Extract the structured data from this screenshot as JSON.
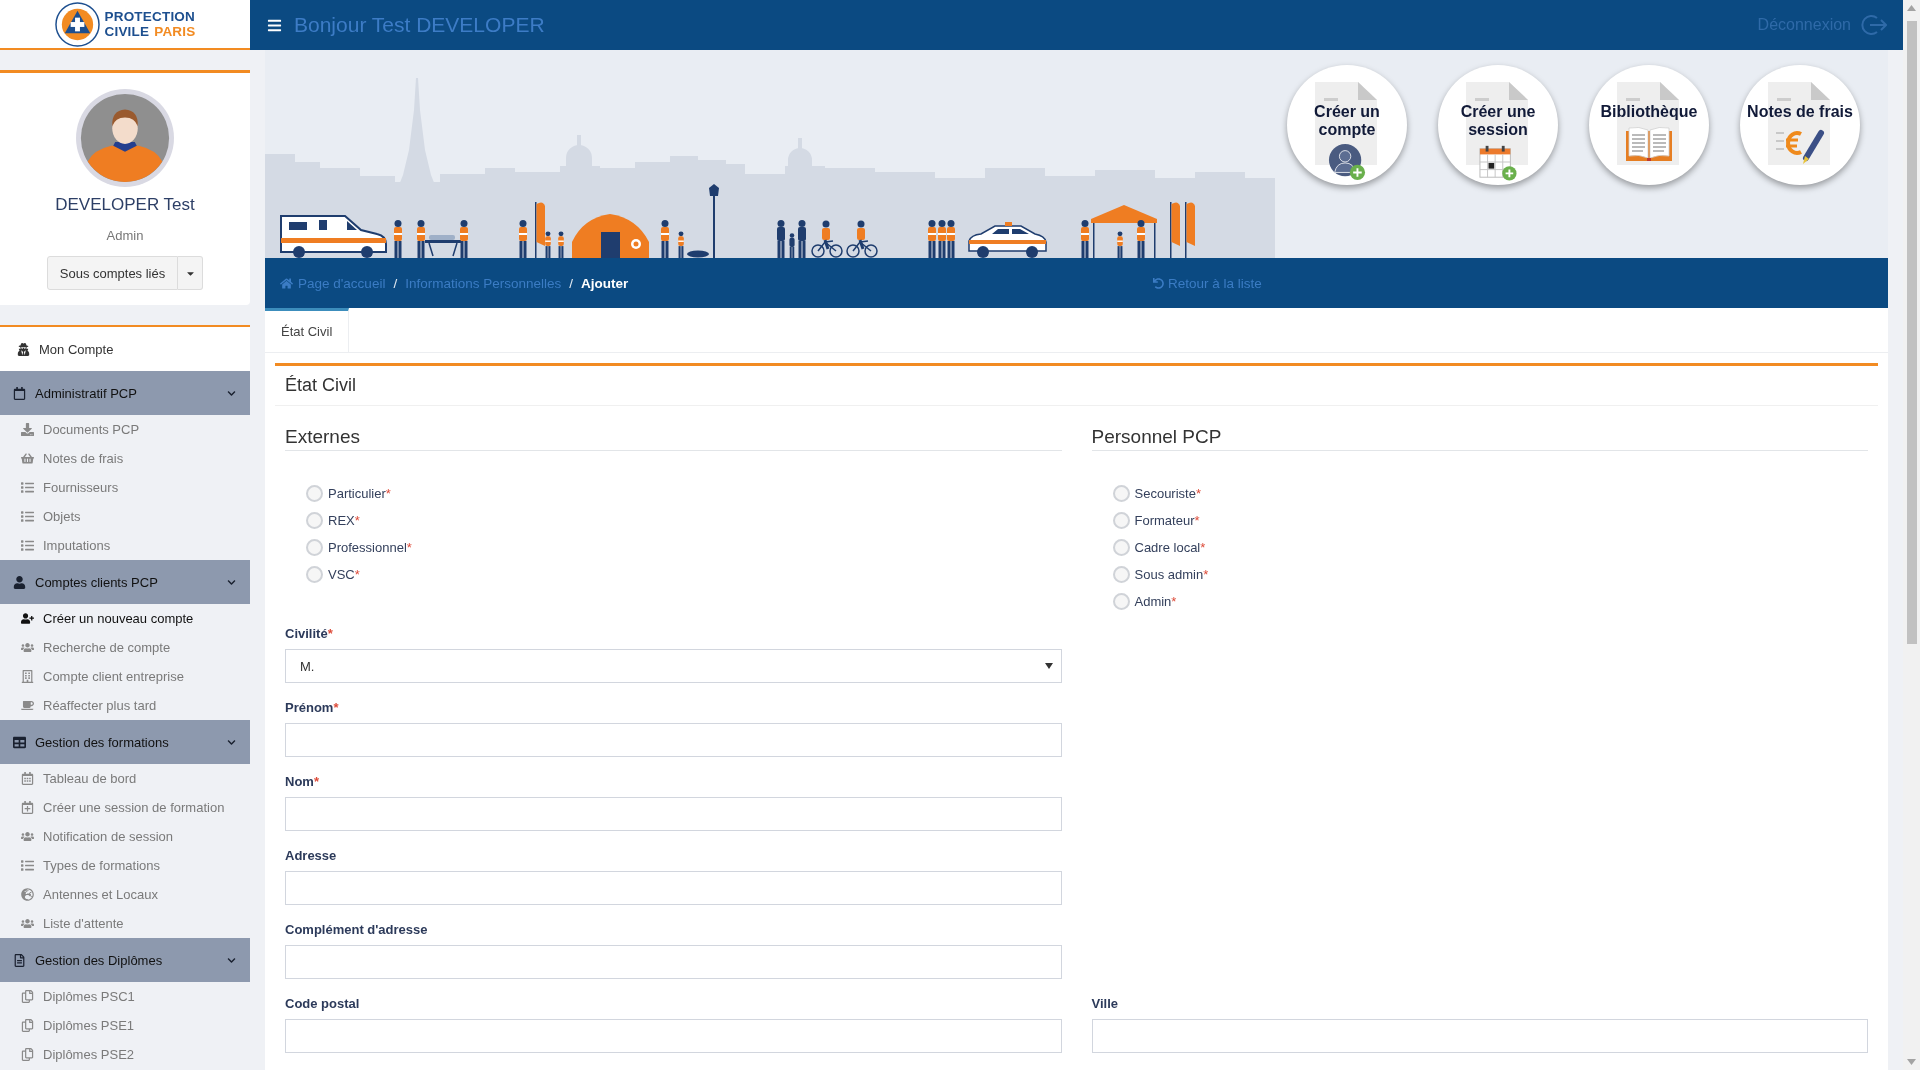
{
  "logo": {
    "title": "PROTECTION",
    "subtitle": "CIVILE",
    "accent": "PARIS"
  },
  "top_bar": {
    "greeting": "Bonjour Test DEVELOPER",
    "logout": "Déconnexion"
  },
  "sidebar": {
    "profile": {
      "name": "DEVELOPER Test",
      "role": "Admin",
      "linked_accounts_button": "Sous comptes liés"
    },
    "menu": [
      {
        "kind": "link",
        "label": "Mon Compte"
      },
      {
        "kind": "group",
        "label": "Administratif PCP",
        "expanded": true,
        "children": [
          {
            "label": "Documents PCP",
            "selected": false
          },
          {
            "label": "Notes de frais",
            "selected": false
          },
          {
            "label": "Fournisseurs",
            "selected": false
          },
          {
            "label": "Objets",
            "selected": false
          },
          {
            "label": "Imputations",
            "selected": false
          }
        ]
      },
      {
        "kind": "group",
        "label": "Comptes clients PCP",
        "expanded": true,
        "children": [
          {
            "label": "Créer un nouveau compte",
            "selected": true
          },
          {
            "label": "Recherche de compte",
            "selected": false
          },
          {
            "label": "Compte client entreprise",
            "selected": false
          },
          {
            "label": "Réaffecter plus tard",
            "selected": false
          }
        ]
      },
      {
        "kind": "group",
        "label": "Gestion des formations",
        "expanded": true,
        "children": [
          {
            "label": "Tableau de bord",
            "selected": false
          },
          {
            "label": "Créer une session de formation",
            "selected": false
          },
          {
            "label": "Notification de session",
            "selected": false
          },
          {
            "label": "Types de formations",
            "selected": false
          },
          {
            "label": "Antennes et Locaux",
            "selected": false
          },
          {
            "label": "Liste d'attente",
            "selected": false
          }
        ]
      },
      {
        "kind": "group",
        "label": "Gestion des Diplômes",
        "expanded": true,
        "children": [
          {
            "label": "Diplômes PSC1",
            "selected": false
          },
          {
            "label": "Diplômes PSE1",
            "selected": false
          },
          {
            "label": "Diplômes PSE2",
            "selected": false
          }
        ]
      }
    ]
  },
  "banner": {
    "shortcuts": [
      {
        "label": "Créer un compte"
      },
      {
        "label": "Créer une session"
      },
      {
        "label": "Bibliothèque"
      },
      {
        "label": "Notes de frais"
      }
    ]
  },
  "breadcrumb": {
    "items": [
      {
        "label": "Page d'accueil",
        "current": false
      },
      {
        "separator": "/",
        "label": "Informations Personnelles",
        "current": false
      },
      {
        "separator": "/",
        "label": "Ajouter",
        "current": true
      }
    ],
    "back_link": "Retour à la liste"
  },
  "tabs": [
    {
      "label": "État Civil",
      "selected": true
    }
  ],
  "panel": {
    "title": "État Civil",
    "role_groups": [
      {
        "title": "Externes",
        "options": [
          {
            "label": "Particulier",
            "required_mark": "*",
            "selected": false
          },
          {
            "label": "REX",
            "required_mark": "*",
            "selected": false
          },
          {
            "label": "Professionnel",
            "required_mark": "*",
            "selected": false
          },
          {
            "label": "VSC",
            "required_mark": "*",
            "selected": false
          }
        ]
      },
      {
        "title": "Personnel PCP",
        "options": [
          {
            "label": "Secouriste",
            "required_mark": "*",
            "selected": false
          },
          {
            "label": "Formateur",
            "required_mark": "*",
            "selected": false
          },
          {
            "label": "Cadre local",
            "required_mark": "*",
            "selected": false
          },
          {
            "label": "Sous admin",
            "required_mark": "*",
            "selected": false
          },
          {
            "label": "Admin",
            "required_mark": "*",
            "selected": false
          }
        ]
      }
    ],
    "field_rows": [
      [
        {
          "kind": "select",
          "label": "Civilité",
          "required_mark": "*",
          "value": "M."
        }
      ],
      [
        {
          "kind": "text",
          "label": "Prénom",
          "required_mark": "*"
        }
      ],
      [
        {
          "kind": "text",
          "label": "Nom",
          "required_mark": "*"
        }
      ],
      [
        {
          "kind": "text",
          "label": "Adresse"
        }
      ],
      [
        {
          "kind": "text",
          "label": "Complément d'adresse"
        }
      ],
      [
        {
          "kind": "text",
          "label": "Code postal"
        },
        {
          "kind": "text",
          "label": "Ville"
        }
      ]
    ]
  }
}
